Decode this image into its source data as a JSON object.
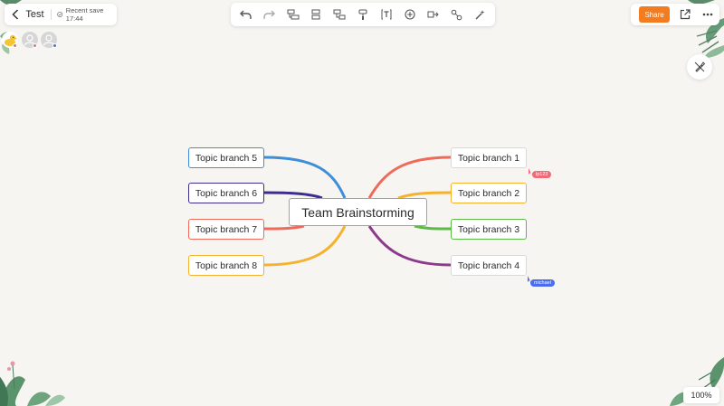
{
  "document": {
    "title": "Test",
    "save_status": "Recent save 17:44"
  },
  "toolbar": {
    "tools": [
      "undo-icon",
      "redo-icon",
      "add-sibling-icon",
      "add-child-icon",
      "add-subtopic-icon",
      "format-painter-icon",
      "text-icon",
      "insert-icon",
      "relationship-icon",
      "link-icon",
      "magic-icon"
    ]
  },
  "actions": {
    "share_label": "Share"
  },
  "mindmap": {
    "root": "Team Brainstorming",
    "branches": [
      {
        "label": "Topic branch 1",
        "color": "#f06a5a"
      },
      {
        "label": "Topic branch 2",
        "color": "#f4b22e"
      },
      {
        "label": "Topic branch 3",
        "color": "#5cba46"
      },
      {
        "label": "Topic branch 4",
        "color": "#8e3a8c"
      },
      {
        "label": "Topic branch 5",
        "color": "#3e8ed8"
      },
      {
        "label": "Topic branch 6",
        "color": "#3b2e8e"
      },
      {
        "label": "Topic branch 7",
        "color": "#f06a5a"
      },
      {
        "label": "Topic branch 8",
        "color": "#f4b22e"
      }
    ]
  },
  "collaborators": [
    {
      "name": "lp123",
      "color": "#f06a78"
    },
    {
      "name": "michael",
      "color": "#4b6cf0"
    }
  ],
  "colors": {
    "accent": "#f47c20",
    "background": "#f7f5f2"
  },
  "zoom": "100%"
}
